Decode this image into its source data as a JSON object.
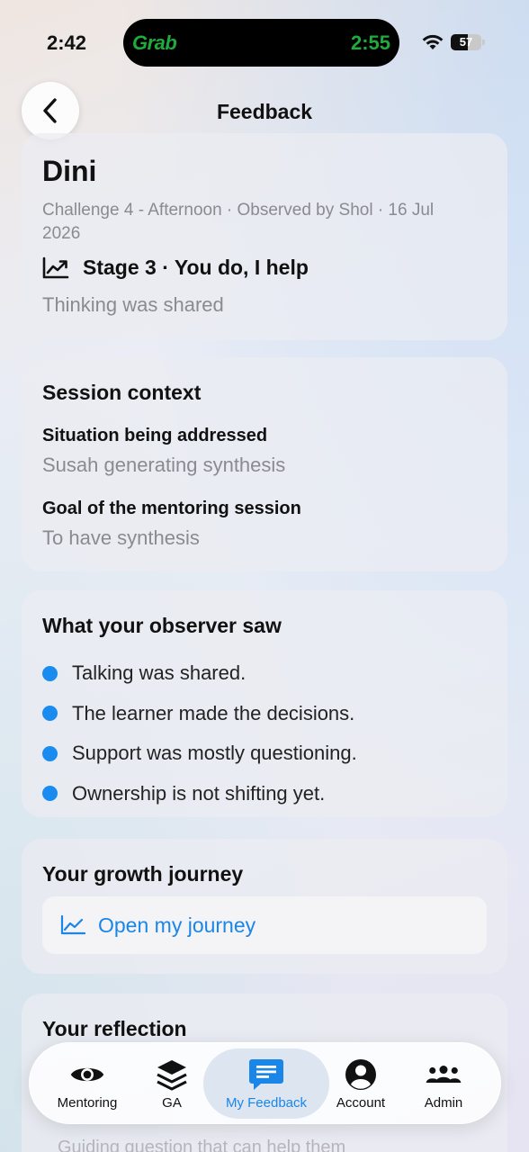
{
  "status_bar": {
    "time": "2:42",
    "island_brand": "Grab",
    "island_time": "2:55",
    "battery": "57",
    "battery_level": 0.57
  },
  "header": {
    "title": "Feedback",
    "back_icon": "chevron-left-icon"
  },
  "summary": {
    "name": "Dini",
    "meta": "Challenge 4 - Afternoon · Observed by Shol · 16 Jul 2026",
    "stage_icon": "trend-chart-icon",
    "stage": "Stage 3 · You do, I help",
    "note": "Thinking was shared"
  },
  "session_context": {
    "title": "Session context",
    "situation_label": "Situation being addressed",
    "situation_value": "Susah generating synthesis",
    "goal_label": "Goal of the mentoring session",
    "goal_value": "To have synthesis"
  },
  "observer": {
    "title": "What your observer saw",
    "items": [
      "Talking was shared.",
      "The learner made the decisions.",
      "Support was mostly questioning.",
      "Ownership is not shifting yet."
    ]
  },
  "growth": {
    "title": "Your growth journey",
    "button_label": "Open my journey",
    "button_icon": "line-chart-icon"
  },
  "reflection": {
    "title": "Your reflection",
    "placeholder": "Guiding question that can help them"
  },
  "tabs": [
    {
      "label": "Mentoring",
      "icon": "eye-icon"
    },
    {
      "label": "GA",
      "icon": "stack-icon"
    },
    {
      "label": "My Feedback",
      "icon": "message-icon",
      "active": true
    },
    {
      "label": "Account",
      "icon": "person-icon"
    },
    {
      "label": "Admin",
      "icon": "group-icon"
    }
  ],
  "colors": {
    "accent": "#1a86e8",
    "bullet": "#1a8cf0",
    "island_text": "#1faa3c"
  }
}
